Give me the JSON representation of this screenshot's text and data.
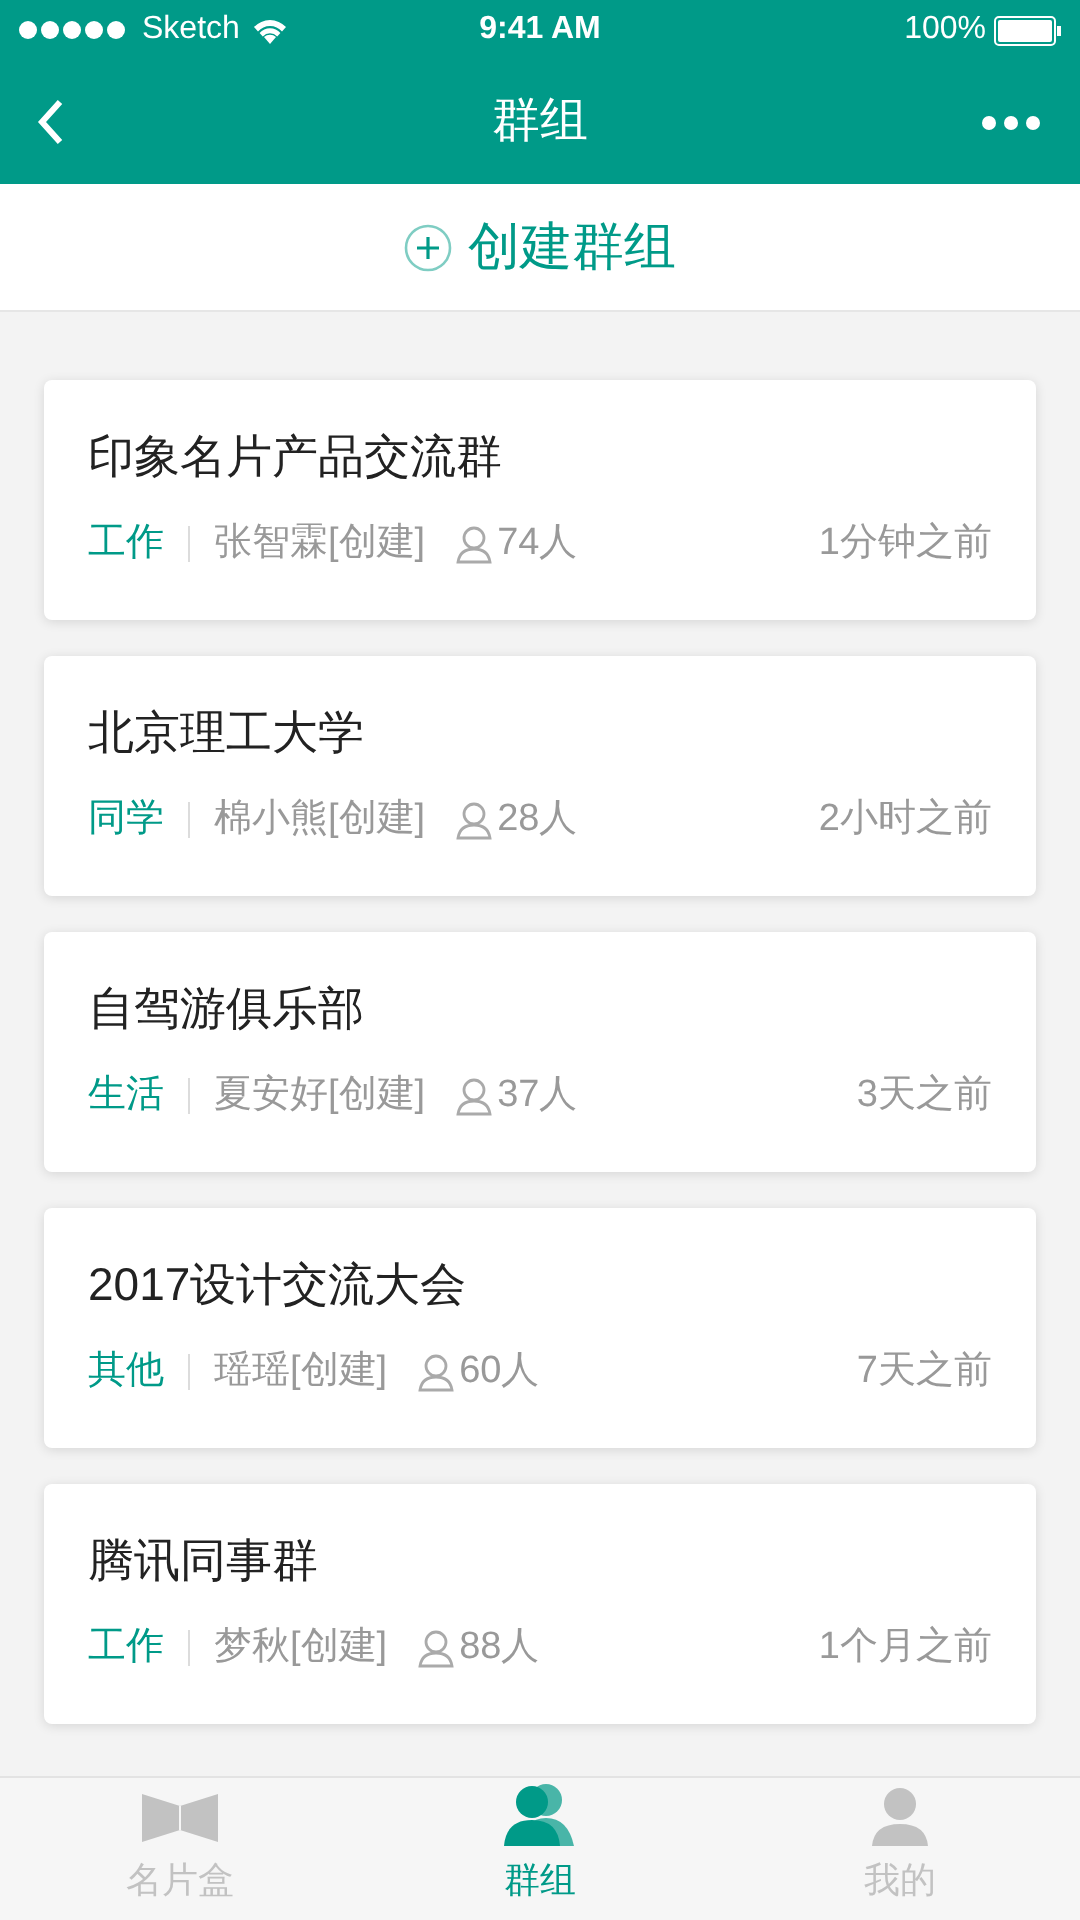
{
  "status_bar": {
    "carrier": "Sketch",
    "time": "9:41 AM",
    "battery": "100%"
  },
  "nav": {
    "title": "群组"
  },
  "create_button": {
    "label": "创建群组"
  },
  "groups": [
    {
      "name": "印象名片产品交流群",
      "tag": "工作",
      "creator": "张智霖[创建]",
      "members": "74人",
      "time": "1分钟之前"
    },
    {
      "name": "北京理工大学",
      "tag": "同学",
      "creator": "棉小熊[创建]",
      "members": "28人",
      "time": "2小时之前"
    },
    {
      "name": "自驾游俱乐部",
      "tag": "生活",
      "creator": "夏安好[创建]",
      "members": "37人",
      "time": "3天之前"
    },
    {
      "name": "2017设计交流大会",
      "tag": "其他",
      "creator": "瑶瑶[创建]",
      "members": "60人",
      "time": "7天之前"
    },
    {
      "name": "腾讯同事群",
      "tag": "工作",
      "creator": "梦秋[创建]",
      "members": "88人",
      "time": "1个月之前"
    }
  ],
  "tab_bar": [
    {
      "kind": "cards",
      "label": "名片盒",
      "selected": false
    },
    {
      "kind": "group",
      "label": "群组",
      "selected": true
    },
    {
      "kind": "me",
      "label": "我的",
      "selected": false
    }
  ]
}
